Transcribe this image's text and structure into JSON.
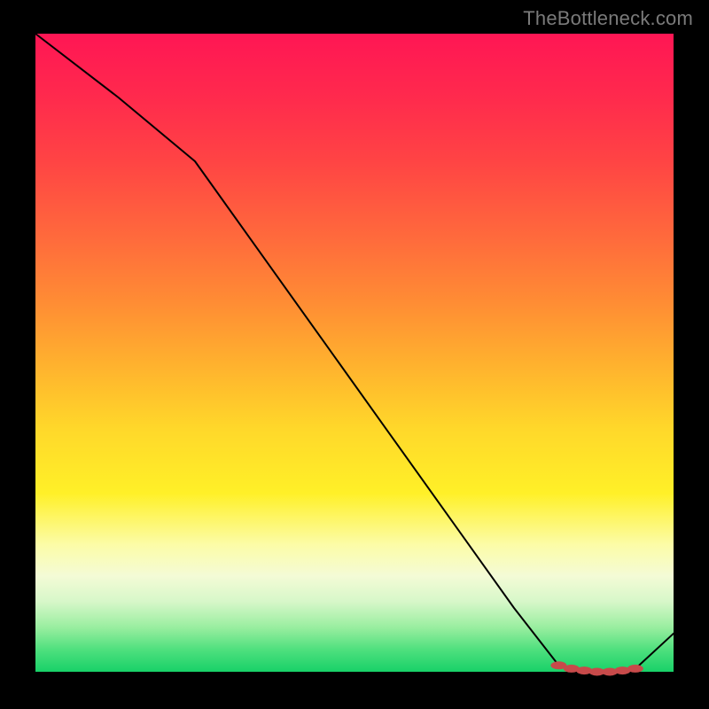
{
  "watermark": "TheBottleneck.com",
  "chart_data": {
    "type": "line",
    "title": "",
    "xlabel": "",
    "ylabel": "",
    "xlim": [
      0,
      100
    ],
    "ylim": [
      0,
      100
    ],
    "series": [
      {
        "name": "curve",
        "x": [
          0,
          13,
          25,
          35,
          45,
          55,
          65,
          75,
          82,
          85,
          90,
          93.5,
          100
        ],
        "values": [
          100,
          90,
          80,
          66,
          52,
          38,
          24,
          10,
          1,
          0,
          0,
          0,
          6
        ],
        "stroke": "#000000",
        "stroke_width": 2
      }
    ],
    "markers": {
      "name": "optimal-range",
      "x": [
        82,
        84,
        86,
        88,
        90,
        92,
        94
      ],
      "values": [
        1.0,
        0.5,
        0.2,
        0.0,
        0.0,
        0.2,
        0.5
      ],
      "shape": "ellipse",
      "color": "#c74a4a"
    }
  }
}
